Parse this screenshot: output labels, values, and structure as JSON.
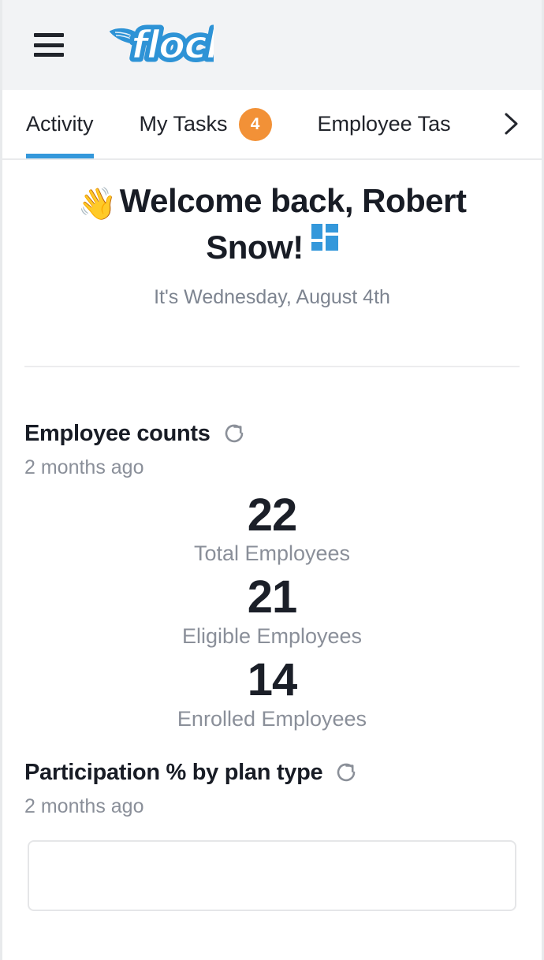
{
  "header": {
    "menu_icon": "hamburger-menu-icon",
    "brand_name": "flock",
    "brand_color": "#2e93d6"
  },
  "tabs": {
    "items": [
      {
        "label": "Activity",
        "badge": null,
        "active": true
      },
      {
        "label": "My Tasks",
        "badge": "4",
        "active": false
      },
      {
        "label": "Employee Tas",
        "badge": null,
        "active": false
      }
    ],
    "next_icon": "chevron-right-icon",
    "active_color": "#3498db",
    "badge_color": "#f29137"
  },
  "welcome": {
    "emoji": "👋",
    "title": "Welcome back, Robert Snow!",
    "subtitle": "It's Wednesday, August 4th",
    "grid_icon": "dashboard-grid-icon",
    "grid_icon_color": "#3498db"
  },
  "employee_counts": {
    "title": "Employee counts",
    "refresh_icon": "refresh-icon",
    "updated": "2 months ago",
    "stats": [
      {
        "value": "22",
        "label": "Total Employees"
      },
      {
        "value": "21",
        "label": "Eligible Employees"
      },
      {
        "value": "14",
        "label": "Enrolled Employees"
      }
    ]
  },
  "participation": {
    "title": "Participation % by plan type",
    "refresh_icon": "refresh-icon",
    "updated": "2 months ago"
  }
}
